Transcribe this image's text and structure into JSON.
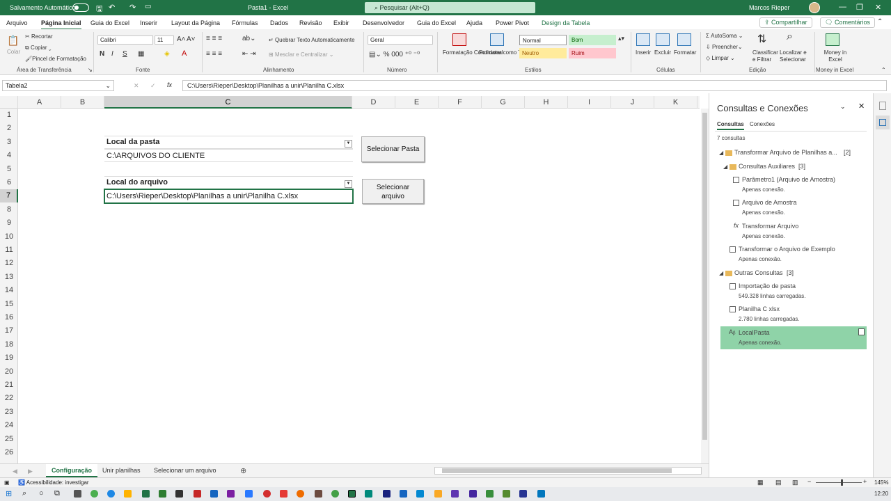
{
  "titlebar": {
    "autosave_label": "Salvamento Automático",
    "doc_title": "Pasta1  -  Excel",
    "search_placeholder": "Pesquisar (Alt+Q)",
    "user_name": "Marcos Rieper"
  },
  "menu": {
    "tabs": [
      "Arquivo",
      "Página Inicial",
      "Guia do Excel",
      "Inserir",
      "Layout da Página",
      "Fórmulas",
      "Dados",
      "Revisão",
      "Exibir",
      "Desenvolvedor",
      "Guia do Excel",
      "Ajuda",
      "Power Pivot",
      "Design da Tabela"
    ],
    "active_tab": "Página Inicial",
    "share_label": "Compartilhar",
    "comments_label": "Comentários"
  },
  "ribbon": {
    "clipboard": {
      "paste": "Colar",
      "cut": "Recortar",
      "copy": "Copiar",
      "format_painter": "Pincel de Formatação",
      "group": "Área de Transferência"
    },
    "font": {
      "name": "Calibri",
      "size": "11",
      "group": "Fonte"
    },
    "alignment": {
      "wrap": "Quebrar Texto Automaticamente",
      "merge": "Mesclar e Centralizar",
      "group": "Alinhamento"
    },
    "number": {
      "format": "Geral",
      "group": "Número"
    },
    "styles": {
      "conditional": "Formatação Condicional",
      "format_table": "Formatar como Tabela",
      "normal": "Normal",
      "good": "Bom",
      "neutral": "Neutro",
      "bad": "Ruim",
      "group": "Estilos"
    },
    "cells": {
      "insert": "Inserir",
      "delete": "Excluir",
      "format": "Formatar",
      "group": "Células"
    },
    "editing": {
      "autosum": "AutoSoma",
      "fill": "Preencher",
      "clear": "Limpar",
      "sort": "Classificar e Filtrar",
      "find": "Localizar e Selecionar",
      "group": "Edição"
    },
    "money": {
      "label": "Money in Excel",
      "group": "Money in Excel"
    }
  },
  "formula_bar": {
    "name_box": "Tabela2",
    "formula": "C:\\Users\\Rieper\\Desktop\\Planilhas a unir\\Planilha C.xlsx"
  },
  "grid": {
    "columns": [
      "A",
      "B",
      "C",
      "D",
      "E",
      "F",
      "G",
      "H",
      "I",
      "J",
      "K"
    ],
    "selected_column": "C",
    "rows": [
      "1",
      "2",
      "3",
      "4",
      "5",
      "6",
      "7",
      "8",
      "9",
      "10",
      "11",
      "12",
      "13",
      "14",
      "15",
      "16",
      "17",
      "18",
      "19",
      "20",
      "21",
      "22",
      "23",
      "24",
      "25",
      "26"
    ],
    "selected_row": "7",
    "folder_header": "Local da pasta",
    "folder_value": "C:\\ARQUIVOS DO CLIENTE",
    "file_header": "Local do arquivo",
    "file_value": "C:\\Users\\Rieper\\Desktop\\Planilhas a unir\\Planilha C.xlsx",
    "btn_select_folder": "Selecionar Pasta",
    "btn_select_file_line1": "Selecionar",
    "btn_select_file_line2": "arquivo"
  },
  "sheets": {
    "tabs": [
      "Configuração",
      "Unir planilhas",
      "Selecionar um arquivo"
    ],
    "active": "Configuração"
  },
  "pane": {
    "title": "Consultas e Conexões",
    "tab_queries": "Consultas",
    "tab_connections": "Conexões",
    "count": "7 consultas",
    "group1": "Transformar Arquivo de Planilhas a...",
    "group1_count": "[2]",
    "group2": "Consultas Auxiliares",
    "group2_count": "[3]",
    "items": [
      {
        "name": "Parâmetro1 (Arquivo de Amostra)",
        "status": "Apenas conexão."
      },
      {
        "name": "Arquivo de Amostra",
        "status": "Apenas conexão."
      },
      {
        "name": "Transformar Arquivo",
        "status": "Apenas conexão."
      },
      {
        "name": "Transformar o Arquivo de Exemplo",
        "status": "Apenas conexão."
      },
      {
        "name": "Importação de pasta",
        "status": "549.328 linhas carregadas."
      },
      {
        "name": "Planilha C xlsx",
        "status": "2.780 linhas carregadas."
      },
      {
        "name": "LocalPasta",
        "status": "Apenas conexão."
      }
    ],
    "group3": "Outras Consultas",
    "group3_count": "[3]"
  },
  "status": {
    "accessibility": "Acessibilidade: investigar",
    "zoom": "145%"
  },
  "taskbar": {
    "time": "12:20"
  },
  "colors": {
    "accent": "#217346",
    "selected_query": "#8fd3a8"
  }
}
